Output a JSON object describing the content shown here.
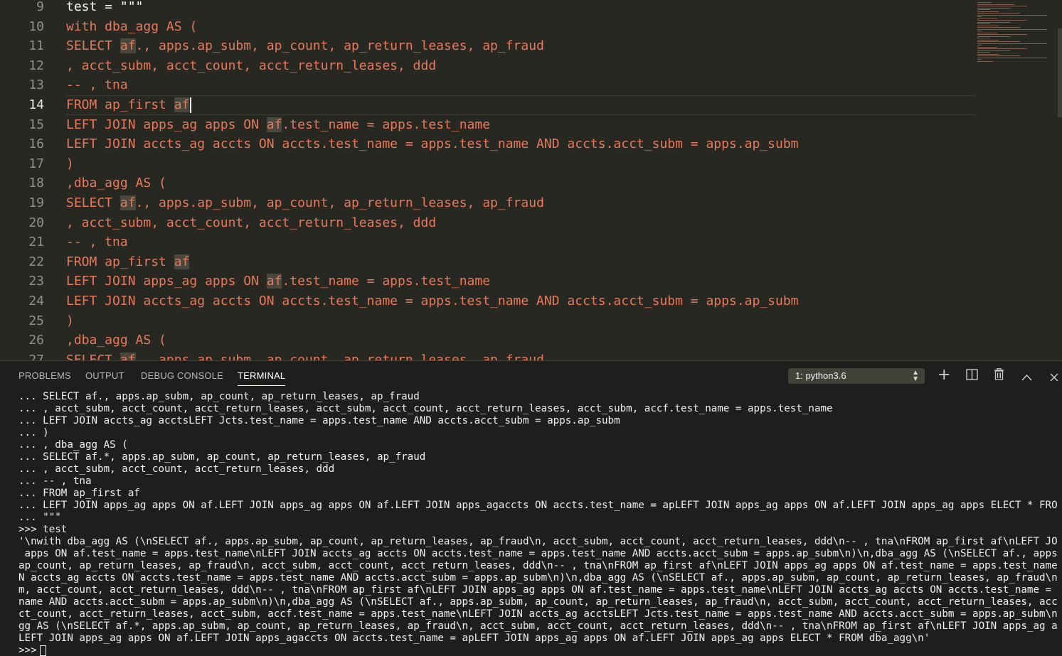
{
  "editor": {
    "lines": [
      {
        "n": "9",
        "text": "test = \"\"\"",
        "plain": true
      },
      {
        "n": "10",
        "text": "with dba_agg AS ("
      },
      {
        "n": "11",
        "text": "SELECT af., apps.ap_subm, ap_count, ap_return_leases, ap_fraud",
        "hl": "af"
      },
      {
        "n": "12",
        "text": ", acct_subm, acct_count, acct_return_leases, ddd"
      },
      {
        "n": "13",
        "text": "-- , tna"
      },
      {
        "n": "14",
        "text": "FROM ap_first af",
        "hl": "af",
        "current": true
      },
      {
        "n": "15",
        "text": "LEFT JOIN apps_ag apps ON af.test_name = apps.test_name",
        "hl": "af"
      },
      {
        "n": "16",
        "text": "LEFT JOIN accts_ag accts ON accts.test_name = apps.test_name AND accts.acct_subm = apps.ap_subm"
      },
      {
        "n": "17",
        "text": ")"
      },
      {
        "n": "18",
        "text": ",dba_agg AS ("
      },
      {
        "n": "19",
        "text": "SELECT af., apps.ap_subm, ap_count, ap_return_leases, ap_fraud",
        "hl": "af"
      },
      {
        "n": "20",
        "text": ", acct_subm, acct_count, acct_return_leases, ddd"
      },
      {
        "n": "21",
        "text": "-- , tna"
      },
      {
        "n": "22",
        "text": "FROM ap_first af",
        "hl": "af"
      },
      {
        "n": "23",
        "text": "LEFT JOIN apps_ag apps ON af.test_name = apps.test_name",
        "hl": "af"
      },
      {
        "n": "24",
        "text": "LEFT JOIN accts_ag accts ON accts.test_name = apps.test_name AND accts.acct_subm = apps.ap_subm"
      },
      {
        "n": "25",
        "text": ")"
      },
      {
        "n": "26",
        "text": ",dba_agg AS ("
      },
      {
        "n": "27",
        "text": "SELECT af., apps.ap_subm, ap_count, ap_return_leases, ap_fraud",
        "hl": "af"
      }
    ]
  },
  "panel": {
    "tabs": [
      "PROBLEMS",
      "OUTPUT",
      "DEBUG CONSOLE",
      "TERMINAL"
    ],
    "active_tab": "TERMINAL",
    "terminal_select": "1: python3.6",
    "icons": [
      "plus-icon",
      "split-icon",
      "trash-icon",
      "chevron-up-icon",
      "close-icon"
    ]
  },
  "terminal": {
    "lines": [
      "... SELECT af., apps.ap_subm, ap_count, ap_return_leases, ap_fraud",
      "... , acct_subm, acct_count, acct_return_leases, acct_subm, acct_count, acct_return_leases, acct_subm, accf.test_name = apps.test_name",
      "... LEFT JOIN accts_ag acctsLEFT Jcts.test_name = apps.test_name AND accts.acct_subm = apps.ap_subm",
      "... )",
      "... , dba_agg AS (",
      "... SELECT af.*, apps.ap_subm, ap_count, ap_return_leases, ap_fraud",
      "... , acct_subm, acct_count, acct_return_leases, ddd",
      "... -- , tna",
      "... FROM ap_first af",
      "... LEFT JOIN apps_ag apps ON af.LEFT JOIN apps_ag apps ON af.LEFT JOIN apps_agaccts ON accts.test_name = apLEFT JOIN apps_ag apps ON af.LEFT JOIN apps_ag apps ELECT * FROM dba_agg",
      "... \"\"\"",
      ">>> test",
      "'\\nwith dba_agg AS (\\nSELECT af., apps.ap_subm, ap_count, ap_return_leases, ap_fraud\\n, acct_subm, acct_count, acct_return_leases, ddd\\n-- , tna\\nFROM ap_first af\\nLEFT JOIN apps_ag",
      " apps ON af.test_name = apps.test_name\\nLEFT JOIN accts_ag accts ON accts.test_name = apps.test_name AND accts.acct_subm = apps.ap_subm\\n)\\n,dba_agg AS (\\nSELECT af., apps.ap_subm,",
      "ap_count, ap_return_leases, ap_fraud\\n, acct_subm, acct_count, acct_return_leases, ddd\\n-- , tna\\nFROM ap_first af\\nLEFT JOIN apps_ag apps ON af.test_name = apps.test_name\\nLEFT JOI",
      "N accts_ag accts ON accts.test_name = apps.test_name AND accts.acct_subm = apps.ap_subm\\n)\\n,dba_agg AS (\\nSELECT af., apps.ap_subm, ap_count, ap_return_leases, ap_fraud\\n, acct_sub",
      "m, acct_count, acct_return_leases, ddd\\n-- , tna\\nFROM ap_first af\\nLEFT JOIN apps_ag apps ON af.test_name = apps.test_name\\nLEFT JOIN accts_ag accts ON accts.test_name = apps.test_",
      "name AND accts.acct_subm = apps.ap_subm\\n)\\n,dba_agg AS (\\nSELECT af., apps.ap_subm, ap_count, ap_return_leases, ap_fraud\\n, acct_subm, acct_count, acct_return_leases, acct_subm, ac",
      "ct_count, acct_return_leases, acct_subm, accf.test_name = apps.test_name\\nLEFT JOIN accts_ag acctsLEFT Jcts.test_name = apps.test_name AND accts.acct_subm = apps.ap_subm\\n)\\n, dba_a",
      "gg AS (\\nSELECT af.*, apps.ap_subm, ap_count, ap_return_leases, ap_fraud\\n, acct_subm, acct_count, acct_return_leases, ddd\\n-- , tna\\nFROM ap_first af\\nLEFT JOIN apps_ag apps ON af.",
      "LEFT JOIN apps_ag apps ON af.LEFT JOIN apps_agaccts ON accts.test_name = apLEFT JOIN apps_ag apps ON af.LEFT JOIN apps_ag apps ELECT * FROM dba_agg\\n'"
    ],
    "prompt": ">>>"
  },
  "colors": {
    "editor_bg": "#272822",
    "panel_bg": "#1e1f1c",
    "string": "#e8795a",
    "text": "#f8f8f2"
  }
}
